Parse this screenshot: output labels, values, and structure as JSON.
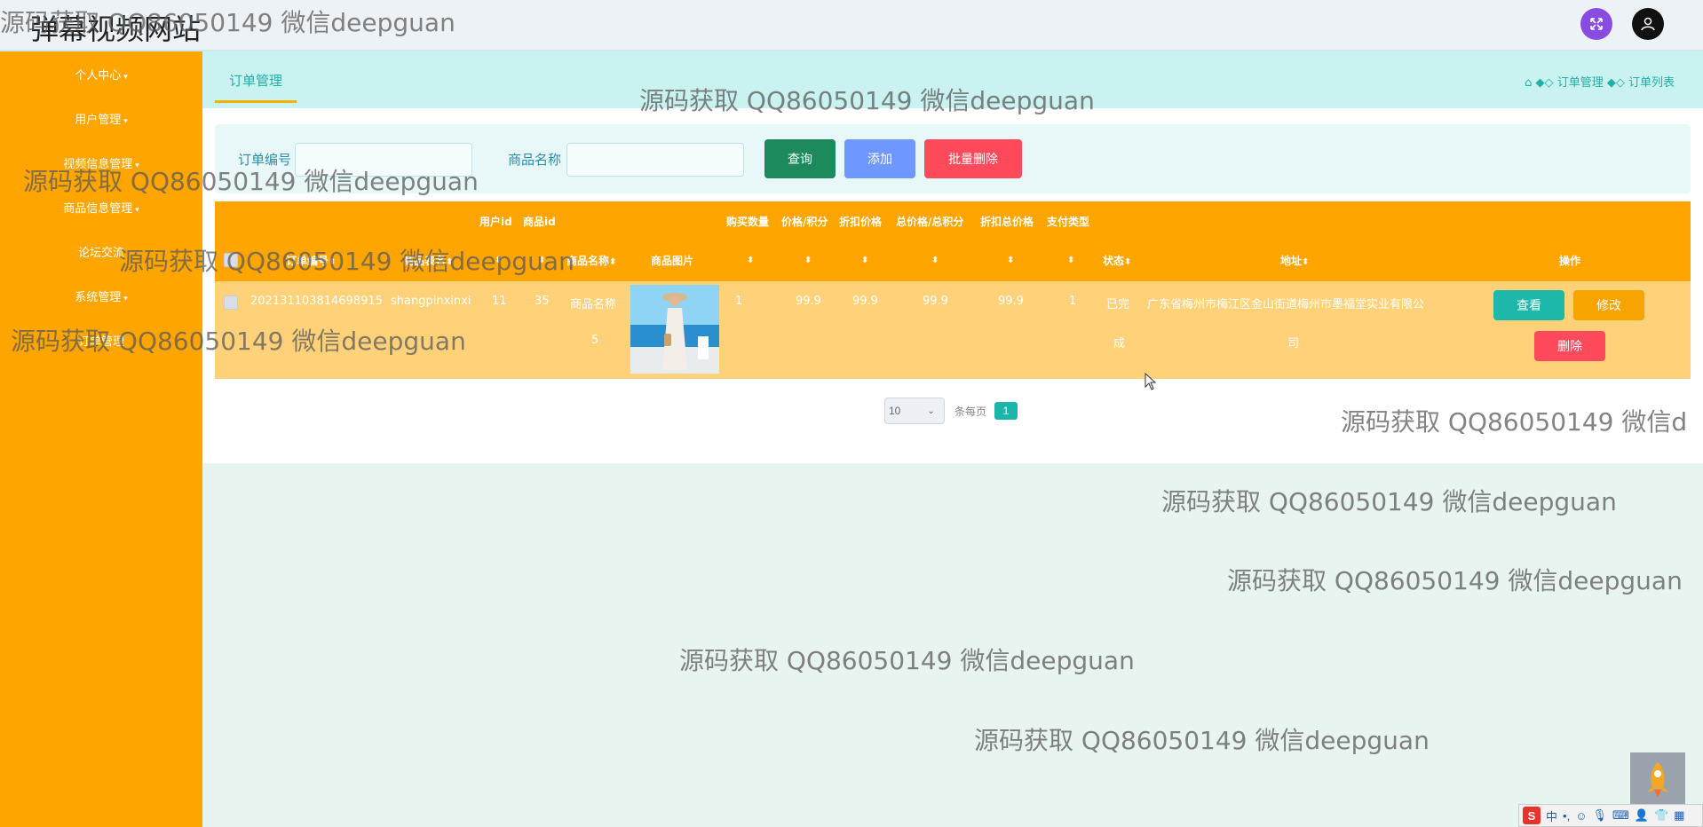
{
  "header": {
    "site_title": "弹幕视频网站"
  },
  "sidebar": {
    "items": [
      {
        "label": "个人中心"
      },
      {
        "label": "用户管理"
      },
      {
        "label": "视频信息管理"
      },
      {
        "label": "商品信息管理"
      },
      {
        "label": "论坛交流"
      },
      {
        "label": "系统管理"
      },
      {
        "label": "订单管理"
      }
    ]
  },
  "tab": {
    "label": "订单管理"
  },
  "breadcrumb": {
    "level1": "订单管理",
    "level2": "订单列表"
  },
  "search": {
    "order_label": "订单编号",
    "product_label": "商品名称",
    "query_button": "查询",
    "add_button": "添加",
    "batch_delete_button": "批量删除"
  },
  "table": {
    "headers": {
      "order_no": "订单编号",
      "table_name": "商品表名",
      "user_id": "用户id",
      "product_id": "商品id",
      "product_name": "商品名称",
      "product_image": "商品图片",
      "quantity": "购买数量",
      "price_points": "价格/积分",
      "discount_price": "折扣价格",
      "total_price": "总价格/总积分",
      "discount_total": "折扣总价格",
      "pay_type": "支付类型",
      "status": "状态",
      "address": "地址",
      "actions": "操作"
    },
    "rows": [
      {
        "order_no": "202131103814698915",
        "table_name": "shangpinxinxi",
        "user_id": "11",
        "product_id": "35",
        "product_name_line1": "商品名称",
        "product_name_line2": "5",
        "quantity": "1",
        "price_points": "99.9",
        "discount_price": "99.9",
        "total_price": "99.9",
        "discount_total": "99.9",
        "pay_type": "1",
        "status_line1": "已完",
        "status_line2": "成",
        "address_line1": "广东省梅州市梅江区金山街道梅州市墨福堂实业有限公",
        "address_line2": "司",
        "view_button": "查看",
        "edit_button": "修改",
        "delete_button": "删除"
      }
    ]
  },
  "pagination": {
    "page_size": "10",
    "per_page_label": "条每页",
    "current_page": "1"
  },
  "watermark": {
    "text": "源码获取 QQ86050149 微信deepguan",
    "text_clipped": "源码获取 QQ86050149 微信d"
  },
  "ime": {
    "mode": "中"
  },
  "colors": {
    "sidebar": "#ffa500",
    "accent": "#1eb1a8",
    "query": "#1d8a5c",
    "add": "#6e97ff",
    "danger": "#ff4a5b"
  }
}
